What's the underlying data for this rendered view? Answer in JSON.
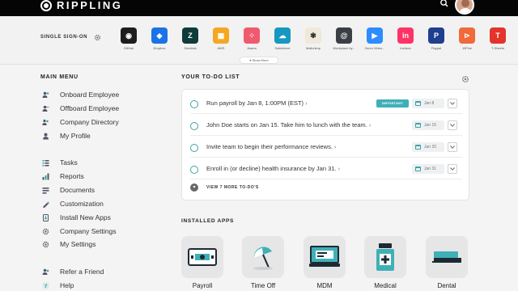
{
  "header": {
    "brand": "RIPPLING",
    "search_icon": "search-icon",
    "avatar_icon": "user-avatar"
  },
  "sso": {
    "label": "SINGLE SIGN-ON",
    "apps": [
      {
        "name": "GitHub",
        "icon": "github-icon",
        "color": "#1d1d1d",
        "glyph": "◉"
      },
      {
        "name": "Dropbox",
        "icon": "dropbox-icon",
        "color": "#1a73e8",
        "glyph": "◆"
      },
      {
        "name": "Zendesk",
        "icon": "zendesk-icon",
        "color": "#0f3b3a",
        "glyph": "Z"
      },
      {
        "name": "AWS",
        "icon": "aws-icon",
        "color": "#f5a623",
        "glyph": "▦"
      },
      {
        "name": "Asana",
        "icon": "asana-icon",
        "color": "#ef5a6f",
        "glyph": "⁘"
      },
      {
        "name": "Salesforce",
        "icon": "salesforce-icon",
        "color": "#1798c1",
        "glyph": "☁"
      },
      {
        "name": "Mailchimp",
        "icon": "mailchimp-icon",
        "color": "#f0e8d8",
        "glyph": "✾"
      },
      {
        "name": "Workplace by...",
        "icon": "workplace-icon",
        "color": "#3b3f45",
        "glyph": "@"
      },
      {
        "name": "Zoom Video...",
        "icon": "zoom-icon",
        "color": "#2d8cff",
        "glyph": "▶"
      },
      {
        "name": "Invision",
        "icon": "invision-icon",
        "color": "#ff3366",
        "glyph": "in"
      },
      {
        "name": "Paypal",
        "icon": "paypal-icon",
        "color": "#1f3f8f",
        "glyph": "P"
      },
      {
        "name": "15Five",
        "icon": "15five-icon",
        "color": "#f06a3b",
        "glyph": "⊳"
      },
      {
        "name": "T-Sheets",
        "icon": "tsheets-icon",
        "color": "#e3332b",
        "glyph": "T"
      }
    ],
    "show_more": "Show More"
  },
  "sidebar": {
    "title": "MAIN MENU",
    "groups": [
      {
        "items": [
          {
            "label": "Onboard Employee",
            "icon": "add-user-icon"
          },
          {
            "label": "Offboard Employee",
            "icon": "remove-user-icon"
          },
          {
            "label": "Company Directory",
            "icon": "directory-icon"
          },
          {
            "label": "My Profile",
            "icon": "profile-icon"
          }
        ]
      },
      {
        "items": [
          {
            "label": "Tasks",
            "icon": "tasks-icon"
          },
          {
            "label": "Reports",
            "icon": "reports-icon"
          },
          {
            "label": "Documents",
            "icon": "documents-icon"
          },
          {
            "label": "Customization",
            "icon": "customization-icon"
          },
          {
            "label": "Install New Apps",
            "icon": "install-apps-icon"
          },
          {
            "label": "Company Settings",
            "icon": "company-settings-icon"
          },
          {
            "label": "My Settings",
            "icon": "my-settings-icon"
          }
        ]
      },
      {
        "items": [
          {
            "label": "Refer a Friend",
            "icon": "refer-friend-icon"
          },
          {
            "label": "Help",
            "icon": "help-icon"
          }
        ]
      }
    ]
  },
  "todo": {
    "title": "YOUR TO-DO LIST",
    "items": [
      {
        "text": "Run payroll by Jan 8, 1:00PM (EST)",
        "badge": "IMPORTANT",
        "date": "Jan 8"
      },
      {
        "text": "John Doe starts on Jan 15. Take him to lunch with the team.",
        "badge": "",
        "date": "Jan 15"
      },
      {
        "text": "Invite team to begin their performance reviews.",
        "badge": "",
        "date": "Jan 20"
      },
      {
        "text": "Enroll in (or decline) health insurance by Jan 31.",
        "badge": "",
        "date": "Jan 31"
      }
    ],
    "view_more": "VIEW 7 MORE TO-DO'S"
  },
  "installed": {
    "title": "INSTALLED APPS",
    "apps": [
      {
        "name": "Payroll",
        "icon": "payroll-icon"
      },
      {
        "name": "Time Off",
        "icon": "time-off-icon"
      },
      {
        "name": "MDM",
        "icon": "mdm-icon"
      },
      {
        "name": "Medical",
        "icon": "medical-icon"
      },
      {
        "name": "Dental",
        "icon": "dental-icon"
      }
    ]
  },
  "colors": {
    "accent": "#3aa4a8",
    "badge": "#3fb0b8",
    "topbar": "#050505"
  }
}
